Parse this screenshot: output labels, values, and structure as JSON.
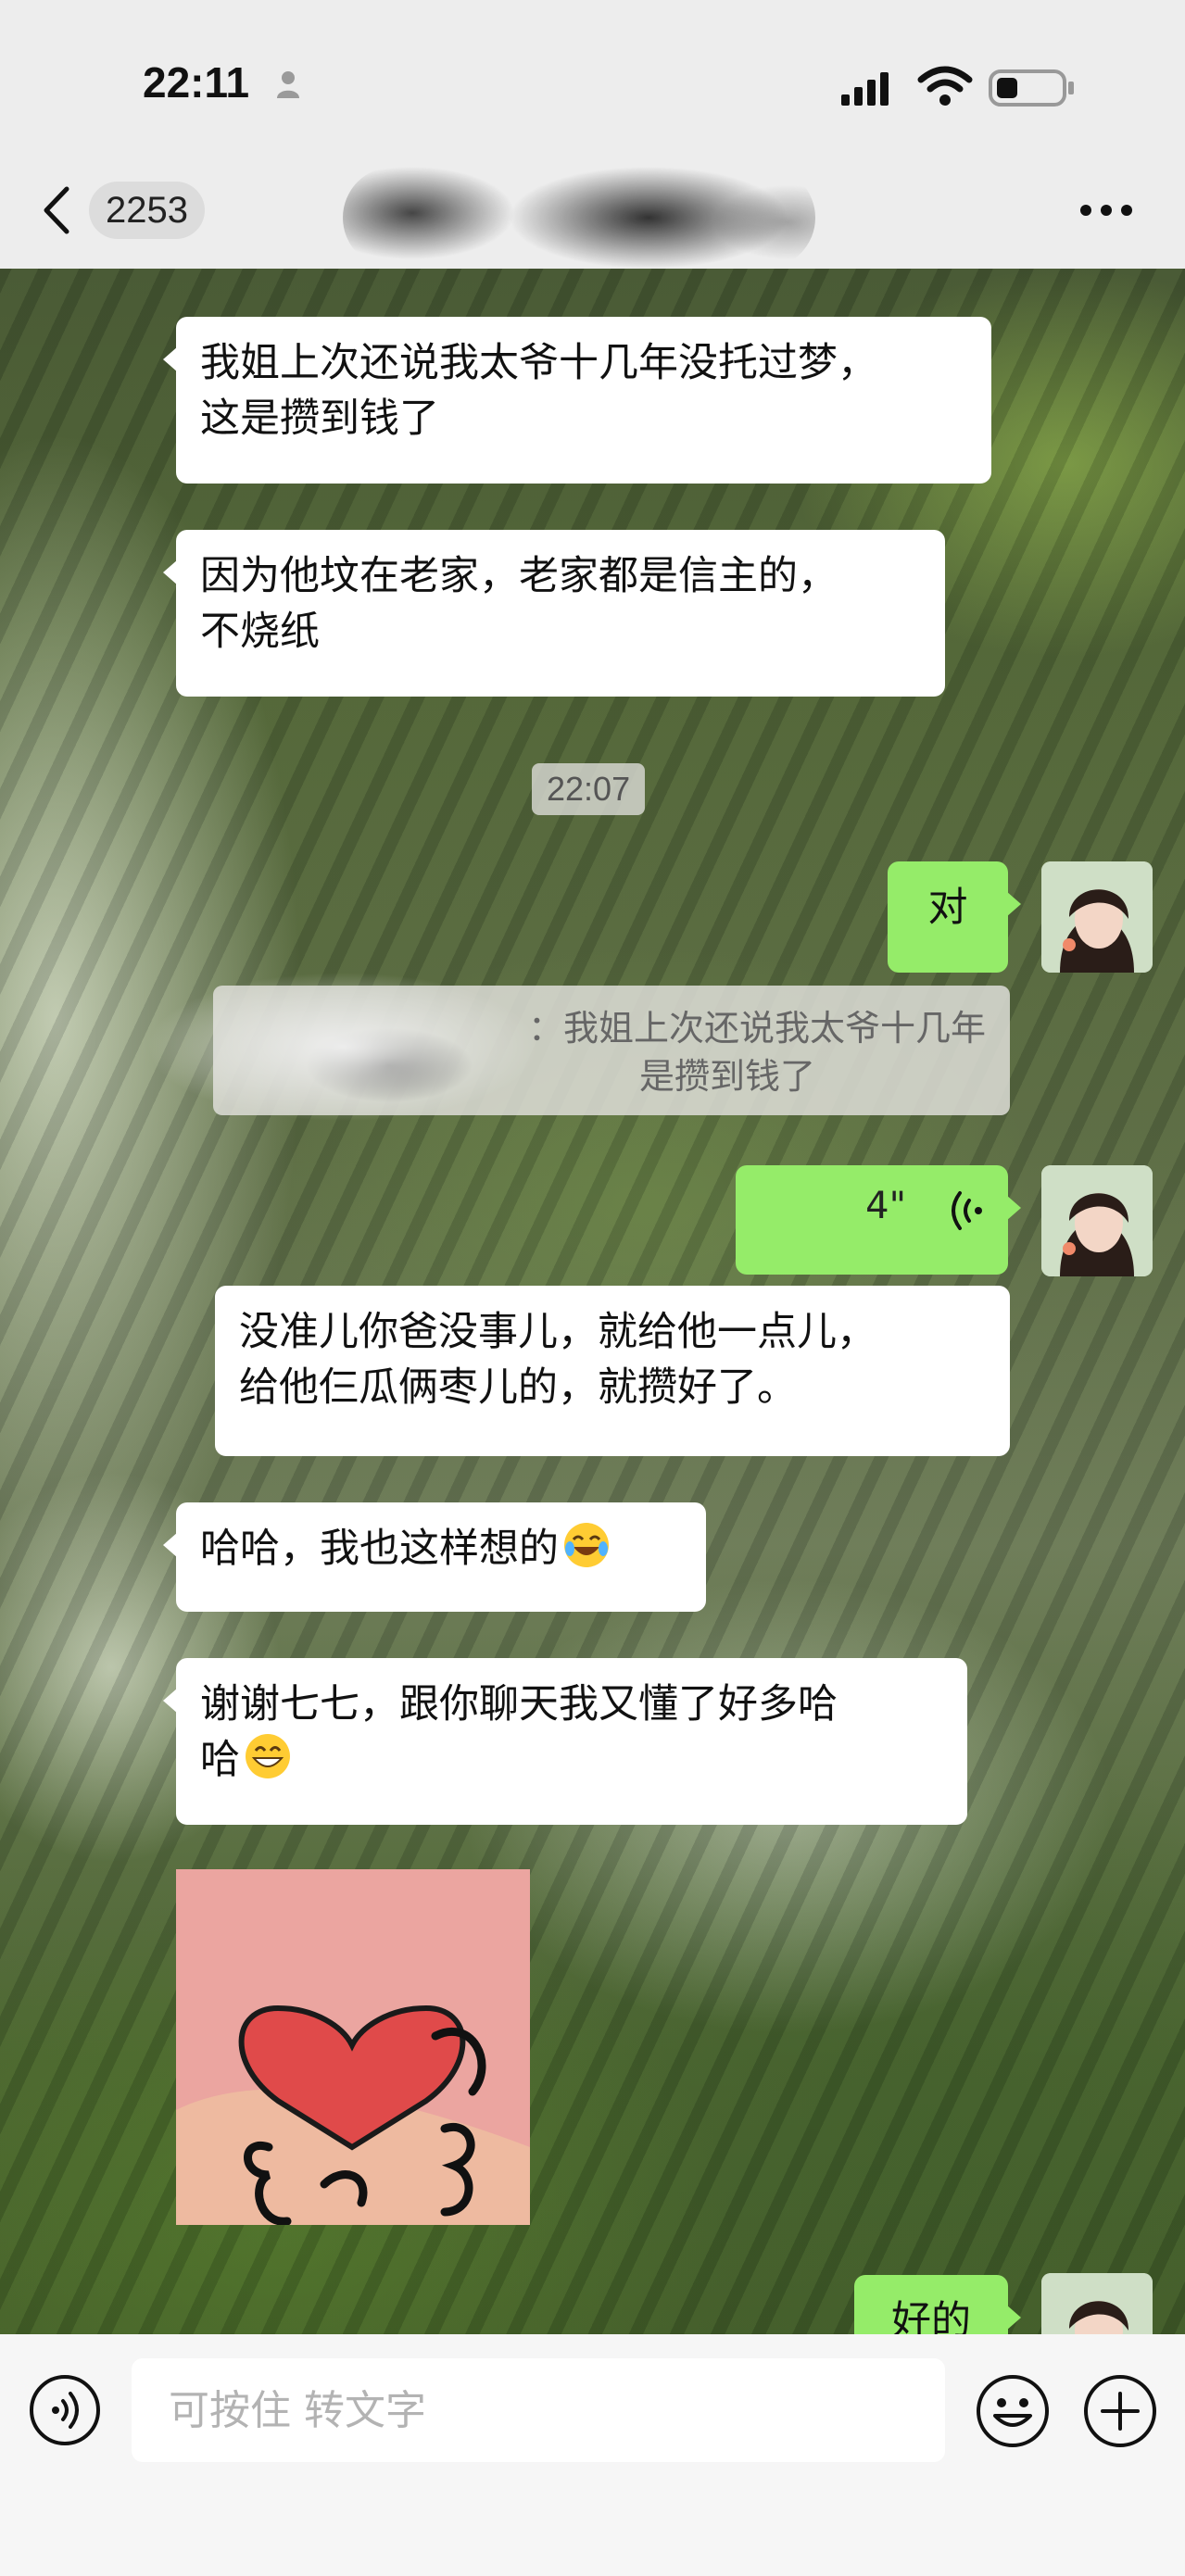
{
  "status_bar": {
    "time": "22:11",
    "icons": [
      "person-icon",
      "signal-icon",
      "wifi-icon",
      "battery-icon"
    ]
  },
  "nav": {
    "back_count": "2253",
    "contact_name": "",
    "icons": [
      "back-icon",
      "more-icon"
    ]
  },
  "messages": [
    {
      "side": "left",
      "lines": [
        "我姐上次还说我太爷十几年没托过梦，",
        "这是攒到钱了"
      ]
    },
    {
      "side": "left",
      "lines": [
        "因为他坟在老家，老家都是信主的，",
        "不烧纸"
      ]
    },
    {
      "type": "timestamp",
      "text": "22:07"
    },
    {
      "side": "right",
      "text": "对"
    },
    {
      "type": "quote",
      "lines": [
        "：我姐上次还说我太爷十几年",
        "是攒到钱了"
      ]
    },
    {
      "side": "right",
      "type": "voice",
      "duration": "4\""
    },
    {
      "side": "right",
      "lines": [
        "没准儿你爸没事儿，就给他一点儿，",
        "给他仨瓜俩枣儿的，就攒好了。"
      ]
    },
    {
      "side": "left",
      "text": "哈哈，我也这样想的",
      "emoji": "tears-of-joy-emoji"
    },
    {
      "side": "left",
      "lines": [
        "谢谢七七，跟你聊天我又懂了好多哈",
        "哈"
      ],
      "emoji": "grinning-emoji"
    },
    {
      "side": "left",
      "type": "sticker",
      "sticker": "heart-hands-sticker"
    },
    {
      "side": "right",
      "text": "好的"
    }
  ],
  "input": {
    "placeholder": "可按住 转文字",
    "value": ""
  },
  "colors": {
    "sent_bubble": "#95ec69",
    "received_bubble": "#ffffff",
    "bar_background": "#ededed"
  }
}
